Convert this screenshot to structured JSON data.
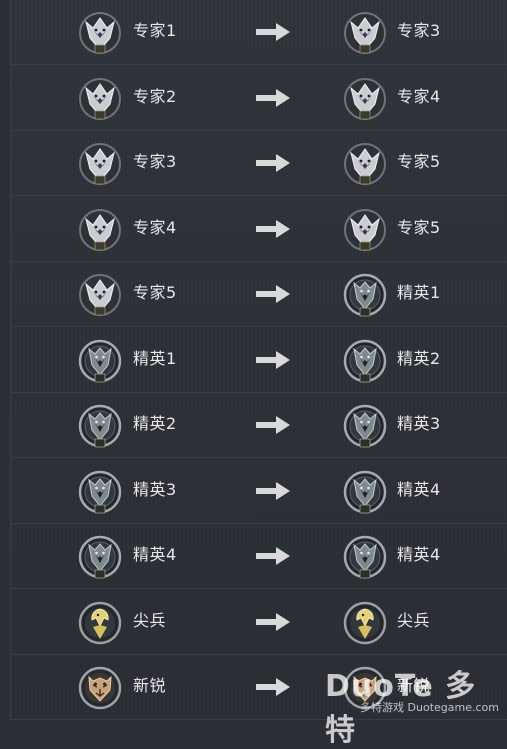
{
  "rows": [
    {
      "from": {
        "label": "专家1",
        "tier": "expert",
        "rank": "I"
      },
      "to": {
        "label": "专家3",
        "tier": "expert",
        "rank": "III"
      }
    },
    {
      "from": {
        "label": "专家2",
        "tier": "expert",
        "rank": "II"
      },
      "to": {
        "label": "专家4",
        "tier": "expert",
        "rank": "IV"
      }
    },
    {
      "from": {
        "label": "专家3",
        "tier": "expert",
        "rank": "III"
      },
      "to": {
        "label": "专家5",
        "tier": "expert",
        "rank": "V"
      }
    },
    {
      "from": {
        "label": "专家4",
        "tier": "expert",
        "rank": "IV"
      },
      "to": {
        "label": "专家5",
        "tier": "expert",
        "rank": "V"
      }
    },
    {
      "from": {
        "label": "专家5",
        "tier": "expert",
        "rank": "V"
      },
      "to": {
        "label": "精英1",
        "tier": "elite",
        "rank": "I"
      }
    },
    {
      "from": {
        "label": "精英1",
        "tier": "elite",
        "rank": "I"
      },
      "to": {
        "label": "精英2",
        "tier": "elite",
        "rank": "II"
      }
    },
    {
      "from": {
        "label": "精英2",
        "tier": "elite",
        "rank": "II"
      },
      "to": {
        "label": "精英3",
        "tier": "elite",
        "rank": "III"
      }
    },
    {
      "from": {
        "label": "精英3",
        "tier": "elite",
        "rank": "III"
      },
      "to": {
        "label": "精英4",
        "tier": "elite",
        "rank": "IV"
      }
    },
    {
      "from": {
        "label": "精英4",
        "tier": "elite",
        "rank": "IV"
      },
      "to": {
        "label": "精英4",
        "tier": "elite",
        "rank": "IV"
      }
    },
    {
      "from": {
        "label": "尖兵",
        "tier": "vanguard",
        "rank": ""
      },
      "to": {
        "label": "尖兵",
        "tier": "vanguard",
        "rank": ""
      }
    },
    {
      "from": {
        "label": "新锐",
        "tier": "rookie",
        "rank": ""
      },
      "to": {
        "label": "新锐",
        "tier": "rookie",
        "rank": ""
      }
    }
  ],
  "icons": {
    "expert": "wolf-emblem-silver-icon",
    "elite": "wolf-emblem-dark-icon",
    "vanguard": "eagle-emblem-icon",
    "rookie": "tiger-emblem-icon",
    "arrow": "arrow-right-icon"
  },
  "colors": {
    "background": "#2b2f35",
    "text": "#e8e8ea",
    "arrow": "#d9d9dc",
    "expert_emblem": "#c9ccd2",
    "elite_emblem": "#7f8a8f",
    "vanguard_accent": "#e3d27a",
    "rookie_accent": "#c8a27a"
  },
  "watermark": {
    "brand": "DuoTe 多特",
    "caption": "多特游戏 Duotegame.com"
  }
}
